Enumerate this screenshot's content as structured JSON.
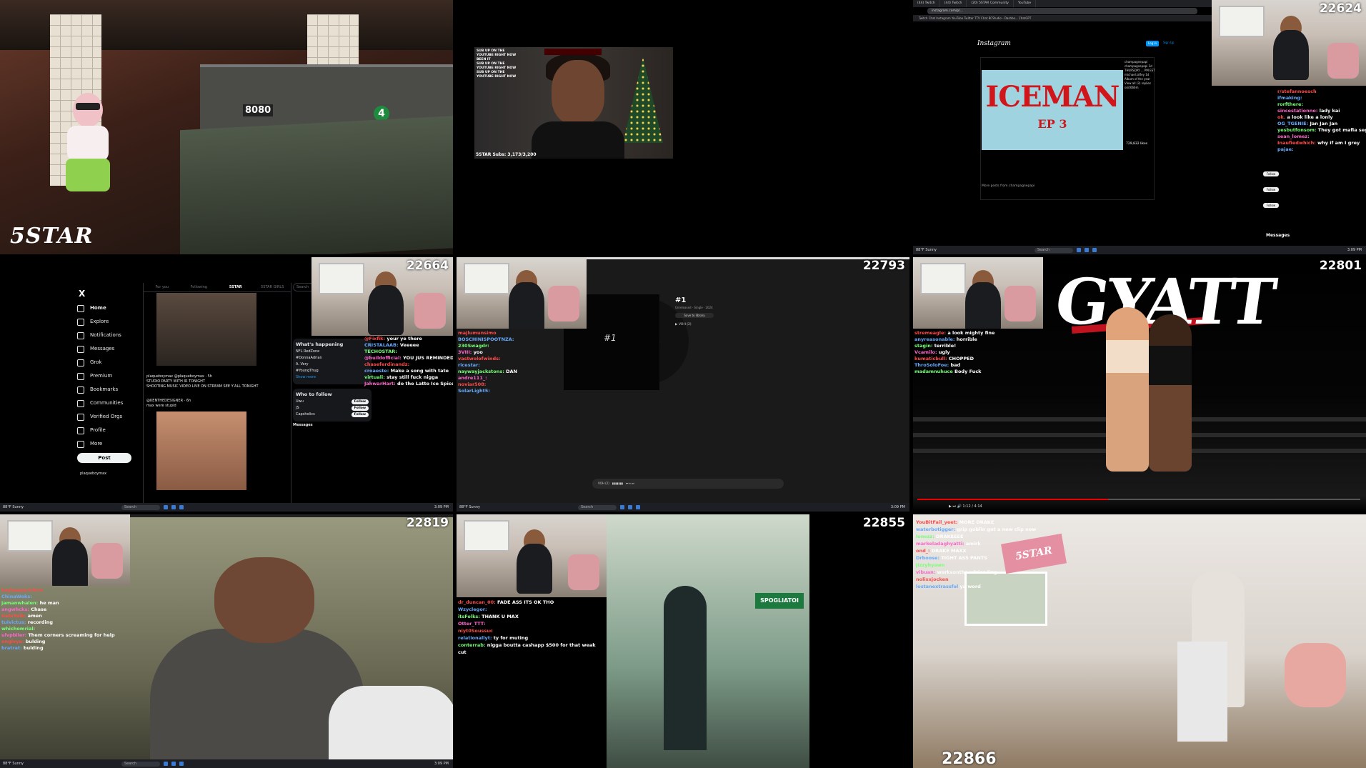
{
  "tiles": {
    "t1": {
      "logo": "5STAR"
    },
    "t2": {
      "overlay_lines": [
        "SUB UP ON THE",
        "YOUTUBE RIGHT NOW",
        "BEEN IT",
        "SUB UP ON THE",
        "YOUTUBE RIGHT NOW",
        "SUB UP ON THE",
        "YOUTUBE RIGHT NOW"
      ],
      "subs": "5STAR Subs: 3,173/3,200"
    },
    "t3": {
      "counter": "22624",
      "tabs": [
        "(44) Twitch",
        "(44) Twitch",
        "(20) 5STAR Community",
        "YouTube"
      ],
      "url": "instagram.com/p/...",
      "bookmarks": "Twitch  Chat  Instagram  YouTube  Twitter  TTV Chat  BCStudio - Dashbo...  ChatGPT",
      "ig_title": "Instagram",
      "login": "Log in",
      "signup": "Sign Up",
      "art_title": "ICEMAN",
      "art_sub": "EP 3",
      "comments": [
        "champagnepapi",
        "champagnepapi  1d",
        "THURSDAY ... PM EST",
        "michael.lafley  1d",
        "Album of the year",
        "View all (3) replies",
        "ssiit666m"
      ],
      "likes": "729,832 likes",
      "more": "More posts from champagnepapi",
      "follow": "Follow",
      "messages": "Messages",
      "chat": [
        {
          "u": "r/stefannoesch",
          "m": ""
        },
        {
          "u": "ifmaking:",
          "m": ""
        },
        {
          "u": "rorfthere:",
          "m": ""
        },
        {
          "u": "sincestationno:",
          "m": "lady kai"
        },
        {
          "u": "ok.",
          "m": "a look like a lonly"
        },
        {
          "u": "OG_TGENIE:",
          "m": "Jan Jan Jan"
        },
        {
          "u": "yesbutfonsom:",
          "m": "They got mafia segment"
        },
        {
          "u": "sean_lomez:",
          "m": ""
        },
        {
          "u": "Inaufiedwhich:",
          "m": "why if am I grey"
        },
        {
          "u": "pajae:",
          "m": ""
        }
      ]
    },
    "t4": {
      "counter": "22664",
      "logo": "X",
      "nav": [
        "Home",
        "Explore",
        "Notifications",
        "Messages",
        "Grok",
        "Premium",
        "Bookmarks",
        "Communities",
        "Verified Orgs",
        "Profile",
        "More"
      ],
      "post_btn": "Post",
      "feed_tabs": [
        "For you",
        "Following",
        "5STAR",
        "5STAR GIRLS"
      ],
      "tweet1": "plaqueboymax  @plaqueboymax · 5h",
      "tweet1_text": "STUDIO PARTY WITH IR TONIGHT",
      "tweet1_text2": "SHOOTING MUSIC VIDEO LIVE ON STREAM SEE Y'ALL TONIGHT",
      "tweet2": "@KENTHEDESIGNER · 6h",
      "tweet2_text": "max were stupid",
      "search": "Search",
      "whats_happening": "What's happening",
      "trends": [
        "NFL RedZone",
        "#DonnaAdrian",
        "A. Very",
        "#YoungThug"
      ],
      "who_to_follow": "Who to follow",
      "follow_names": [
        "Uwu",
        "JS",
        "Capsholics"
      ],
      "follow_btn": "Follow",
      "show_more": "Show more",
      "profile_name": "plaqueboymax",
      "messages": "Messages",
      "chat": [
        {
          "u": "@Fixfik:",
          "m": "your ye there"
        },
        {
          "u": "CRISTALAAB:",
          "m": "Veeeee"
        },
        {
          "u": "TECHOSTAR:",
          "m": ""
        },
        {
          "u": "@buildofficial:",
          "m": "YOU JUS REMINDED ME"
        },
        {
          "u": "chaseferdinandz:",
          "m": ""
        },
        {
          "u": "croaeste:",
          "m": "Make a song with tate"
        },
        {
          "u": "virtuali:",
          "m": "stay still fuck nigga"
        },
        {
          "u": "JahwarHart:",
          "m": "do the Latto Ice Spice IT8 today"
        }
      ]
    },
    "t5": {
      "counter": "22793",
      "cover_title": "#1",
      "track_title": "#1",
      "meta": "Unreleased · Single · 2024",
      "save_btn": "Save to library",
      "row": "VOH (2)",
      "bar_text": "VOH (2)",
      "chat": [
        {
          "u": "majlumunsimo",
          "m": ""
        },
        {
          "u": "BOSCHINISPOOTNZA:",
          "m": ""
        },
        {
          "u": "230Swagdr:",
          "m": ""
        },
        {
          "u": "3VIII:",
          "m": "yoo"
        },
        {
          "u": "vastwolofwinds:",
          "m": ""
        },
        {
          "u": "ricestar:",
          "m": ""
        },
        {
          "u": "naywayjackstons:",
          "m": "DAN"
        },
        {
          "u": "andre111_:",
          "m": ""
        },
        {
          "u": "noviar508:",
          "m": ""
        },
        {
          "u": "SolarLight5:",
          "m": ""
        }
      ]
    },
    "t6": {
      "counter": "22801",
      "title_art": "GYATT",
      "time": "1:12 / 4:14",
      "chat": [
        {
          "u": "stremeagle:",
          "m": "a look mighty fine"
        },
        {
          "u": "anyreasonable:",
          "m": "horrible"
        },
        {
          "u": "stagin:",
          "m": "terrible!"
        },
        {
          "u": "Vcamilo:",
          "m": "ugly"
        },
        {
          "u": "kumaticbull:",
          "m": "CHOPPED"
        },
        {
          "u": "ThroSoloFoe:",
          "m": "bad"
        },
        {
          "u": "madamnuhuce",
          "m": "Body Fuck"
        }
      ]
    },
    "t7": {
      "counter": "22819",
      "chat": [
        {
          "u": "kaybaayerichiro",
          "m": ""
        },
        {
          "u": "ChinaWoks:",
          "m": ""
        },
        {
          "u": "jamanwhalen:",
          "m": "he man"
        },
        {
          "u": "angwhcks:",
          "m": "Chase"
        },
        {
          "u": "GaluYolk:",
          "m": "amen"
        },
        {
          "u": "tuivictus:",
          "m": "recording"
        },
        {
          "u": "whichomrial:",
          "m": ""
        },
        {
          "u": "ulvpbiler:",
          "m": "Them corners screaming for help"
        },
        {
          "u": "ongivya:",
          "m": "bulding"
        },
        {
          "u": "bratrat:",
          "m": "bulding"
        }
      ]
    },
    "t8": {
      "counter": "22855",
      "sign": "SPOGLIATOI",
      "chat": [
        {
          "u": "dr_duncan_00:",
          "m": "FADE ASS ITS OK THO"
        },
        {
          "u": "Wzyclegor:",
          "m": ""
        },
        {
          "u": "itsFolks:",
          "m": "THANK U MAX"
        },
        {
          "u": "Otter_TTT:",
          "m": ""
        },
        {
          "u": "niyt0Soussuc",
          "m": ""
        },
        {
          "u": "relationallyt:",
          "m": "ty for muting"
        },
        {
          "u": "conterrab:",
          "m": "nigga boutta cashapp $500 for that weak cut"
        }
      ]
    },
    "t9": {
      "counter": "22866",
      "flag": "5STAR",
      "chat": [
        {
          "u": "YouBitFail_yeet:",
          "m": "MORE DRAKE"
        },
        {
          "u": "waterbotigger:",
          "m": "grip goblin got a new clip now"
        },
        {
          "u": "lonezz:",
          "m": "DRAKEEEE"
        },
        {
          "u": "markeladaghyatti:",
          "m": "amirk"
        },
        {
          "u": "ond_:",
          "m": "DRAKE MAXX"
        },
        {
          "u": "Drboose:",
          "m": "TIGHT ASS PANTS"
        },
        {
          "u": "Jizzyhyawn",
          "m": ""
        },
        {
          "u": "vibuan:",
          "m": "worksonthe wlzies ling"
        },
        {
          "u": "nolixxjocken",
          "m": ""
        },
        {
          "u": "lostanextrassfol",
          "m": "ya word"
        }
      ]
    }
  },
  "taskbar": {
    "weather": "88°F Sunny",
    "search": "Search",
    "time": "3:09 PM"
  },
  "colors": {
    "twitch_red": "#ff4b4b",
    "x_bg": "#000000",
    "ig_blue": "#0095f6"
  }
}
